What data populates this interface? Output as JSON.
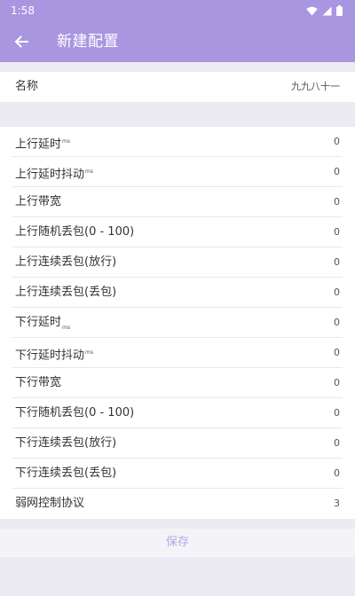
{
  "status_bar": {
    "time": "1:58",
    "icons": [
      "wifi-icon",
      "signal-icon",
      "battery-icon"
    ]
  },
  "toolbar": {
    "title": "新建配置",
    "back_icon": "arrow-back-icon"
  },
  "name_row": {
    "label": "名称",
    "value": "九九八十一"
  },
  "settings": [
    {
      "label": "上行延时",
      "unit": "ms",
      "value": "0"
    },
    {
      "label": "上行延时抖动",
      "unit": "ms",
      "value": "0"
    },
    {
      "label": "上行带宽",
      "unit": "",
      "value": "0"
    },
    {
      "label": "上行随机丢包(0 - 100)",
      "unit": "",
      "value": "0"
    },
    {
      "label": "上行连续丢包(放行)",
      "unit": "",
      "value": "0"
    },
    {
      "label": "上行连续丢包(丢包)",
      "unit": "",
      "value": "0"
    },
    {
      "label": "下行延时",
      "unit": "ms",
      "value": "0"
    },
    {
      "label": "下行延时抖动",
      "unit": "ms",
      "value": "0"
    },
    {
      "label": "下行带宽",
      "unit": "",
      "value": "0"
    },
    {
      "label": "下行随机丢包(0 - 100)",
      "unit": "",
      "value": "0"
    },
    {
      "label": "下行连续丢包(放行)",
      "unit": "",
      "value": "0"
    },
    {
      "label": "下行连续丢包(丢包)",
      "unit": "",
      "value": "0"
    },
    {
      "label": "弱网控制协议",
      "unit": "",
      "value": "3"
    }
  ],
  "save_button": {
    "label": "保存"
  },
  "colors": {
    "accent": "#A996E0",
    "background": "#ECEAF3",
    "save_text": "#B7A8E6"
  }
}
